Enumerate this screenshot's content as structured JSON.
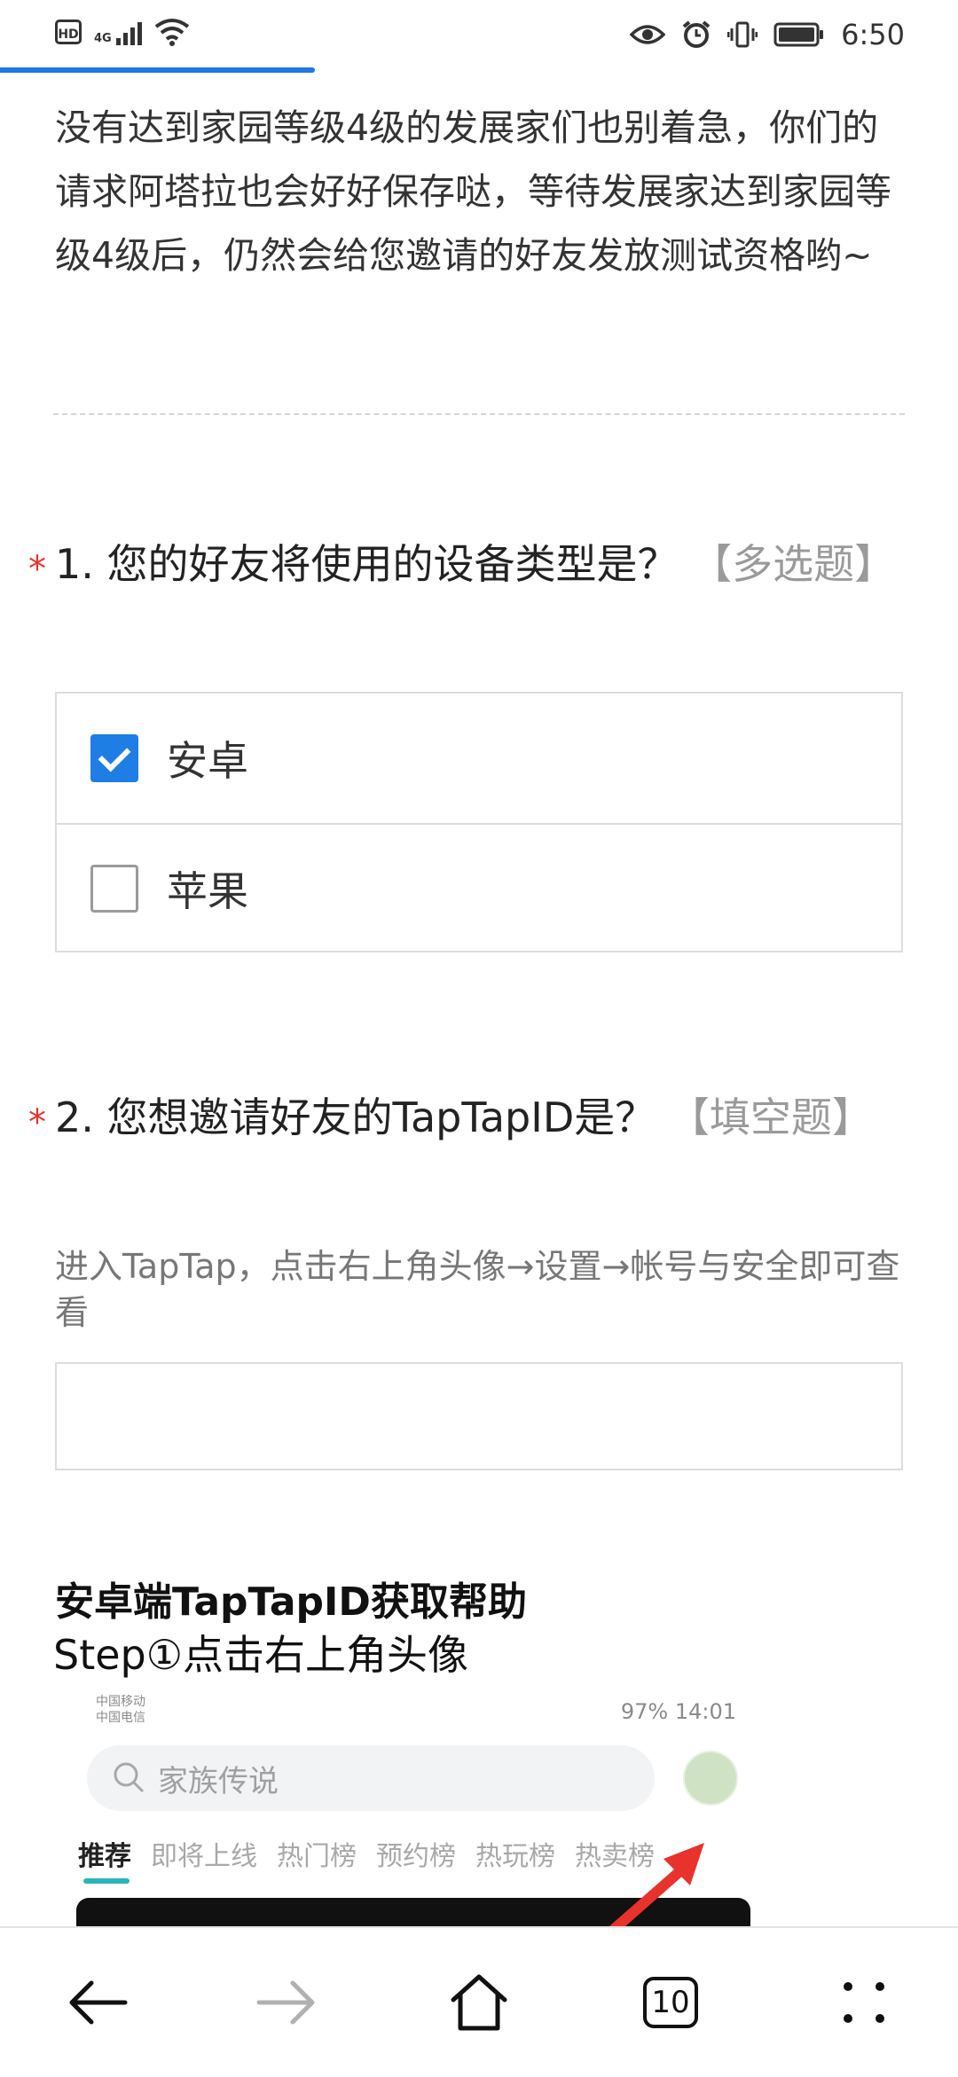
{
  "status_bar": {
    "hd": "HD",
    "network": "4G",
    "time": "6:50",
    "icons": [
      "hd-icon",
      "signal-icon",
      "wifi-icon",
      "eye-icon",
      "alarm-icon",
      "vibrate-icon",
      "battery-icon"
    ]
  },
  "intro_text": "没有达到家园等级4级的发展家们也别着急，你们的请求阿塔拉也会好好保存哒，等待发展家达到家园等级4级后，仍然会给您邀请的好友发放测试资格哟~",
  "questions": [
    {
      "required_mark": "*",
      "title": "1. 您的好友将使用的设备类型是？",
      "type_label": "【多选题】",
      "options": [
        {
          "label": "安卓",
          "checked": true
        },
        {
          "label": "苹果",
          "checked": false
        }
      ]
    },
    {
      "required_mark": "*",
      "title": "2. 您想邀请好友的TapTapID是？",
      "type_label": "【填空题】",
      "hint": "进入TapTap，点击右上角头像→设置→帐号与安全即可查看",
      "input_value": ""
    }
  ],
  "help": {
    "title": "安卓端TapTapID获取帮助",
    "step": "Step①点击右上角头像",
    "image": {
      "carrier_1": "中国移动",
      "carrier_2": "中国电信",
      "status_right": "97%",
      "time": "14:01",
      "search_placeholder": "家族传说",
      "tabs": [
        "推荐",
        "即将上线",
        "热门榜",
        "预约榜",
        "热玩榜",
        "热卖榜"
      ]
    }
  },
  "bottom_nav": {
    "tab_count": "10",
    "buttons": [
      "back-icon",
      "forward-icon",
      "home-icon",
      "tabs-icon",
      "menu-icon"
    ]
  },
  "colors": {
    "accent": "#1f7de6",
    "required": "#e8322b",
    "muted": "#9a9a9a"
  }
}
